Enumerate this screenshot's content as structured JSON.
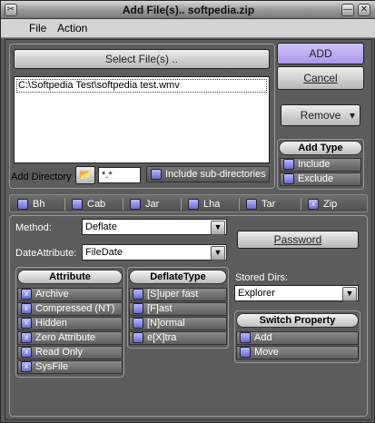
{
  "window": {
    "title": "Add File(s).. softpedia.zip",
    "close_glyph": "✕",
    "minimize_glyph": "—",
    "settings_glyph": "✂"
  },
  "menu": [
    "File",
    "Action"
  ],
  "select_files_label": "Select File(s) ..",
  "file_list": [
    "C:\\Softpedia Test\\softpedia test.wmv"
  ],
  "add_directory": {
    "label": "Add Directory",
    "folder_icon_glyph": "📂",
    "mask_value": "*.*",
    "include_subdirs_label": "Include sub-directories"
  },
  "actions": {
    "add_label": "ADD",
    "cancel_label": "Cancel",
    "remove_label": "Remove",
    "remove_arrow": "▾"
  },
  "add_type": {
    "header": "Add Type",
    "options": [
      "Include",
      "Exclude"
    ]
  },
  "format_tabs": [
    {
      "label": "Bh",
      "checked": false
    },
    {
      "label": "Cab",
      "checked": false
    },
    {
      "label": "Jar",
      "checked": false
    },
    {
      "label": "Lha",
      "checked": false
    },
    {
      "label": "Tar",
      "checked": false
    },
    {
      "label": "Zip",
      "checked": true
    }
  ],
  "method": {
    "label": "Method:",
    "value": "Deflate"
  },
  "date_attribute": {
    "label": "DateAttribute:",
    "value": "FileDate"
  },
  "password_label": "Password",
  "attribute": {
    "header": "Attribute",
    "items": [
      {
        "label": "Archive",
        "checked": true
      },
      {
        "label": "Compressed (NT)",
        "checked": true
      },
      {
        "label": "Hidden",
        "checked": true
      },
      {
        "label": "Zero Attribute",
        "checked": true
      },
      {
        "label": "Read Only",
        "checked": true
      },
      {
        "label": "SysFile",
        "checked": true
      }
    ]
  },
  "deflate_type": {
    "header": "DeflateType",
    "items": [
      "[S]uper fast",
      "[F]ast",
      "[N]ormal",
      "e[X]tra"
    ]
  },
  "stored_dirs": {
    "label": "Stored Dirs:",
    "value": "Explorer"
  },
  "switch_property": {
    "header": "Switch Property",
    "items": [
      "Add",
      "Move"
    ]
  },
  "colors": {
    "add_button": "#b7a6ec",
    "window_bg": "#5c5c5c",
    "check": "#7b7be0"
  }
}
